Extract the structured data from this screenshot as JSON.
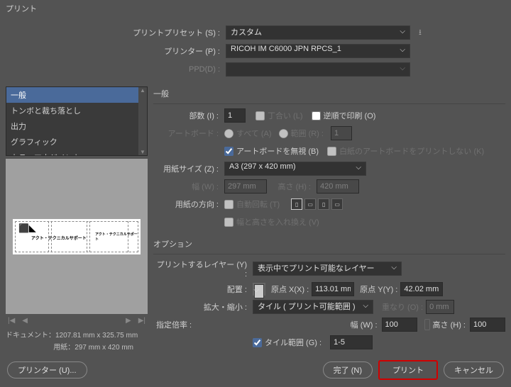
{
  "title": "プリント",
  "presets": {
    "preset_label": "プリントプリセット (S) :",
    "preset_value": "カスタム",
    "printer_label": "プリンター (P) :",
    "printer_value": "RICOH IM C6000 JPN RPCS_1",
    "ppd_label": "PPD(D) :",
    "ppd_value": ""
  },
  "sidebar": {
    "items": [
      "一般",
      "トンボと裁ち落とし",
      "出力",
      "グラフィック",
      "カラーマネジメント"
    ]
  },
  "preview": {
    "nav_page": "",
    "doc_label": "ドキュメント：",
    "doc_value": "1207.81 mm x 325.75 mm",
    "media_label": "用紙：",
    "media_value": "297 mm x 420 mm",
    "art_text1": "アクト・テクニカルサポート",
    "art_text2": "アクト・テクニカルサポート"
  },
  "general": {
    "heading": "一般",
    "copies_label": "部数 (I) :",
    "copies_value": "1",
    "collate_label": "丁合い (L)",
    "reverse_label": "逆順で印刷 (O)",
    "artboard_label": "アートボード :",
    "all_label": "すべて (A)",
    "range_label": "範囲 (R) :",
    "range_value": "1",
    "ignore_ab_label": "アートボードを無視 (B)",
    "skip_blank_label": "白紙のアートボードをプリントしない (K)",
    "size_label": "用紙サイズ (Z) :",
    "size_value": "A3 (297 x 420 mm)",
    "width_label": "幅 (W) :",
    "width_value": "297 mm",
    "height_label": "高さ (H) :",
    "height_value": "420 mm",
    "orient_label": "用紙の方向 :",
    "auto_rotate_label": "自動回転 (T)",
    "transverse_label": "幅と高さを入れ換え (V)"
  },
  "options": {
    "heading": "オプション",
    "layers_label": "プリントするレイヤー (Y) :",
    "layers_value": "表示中でプリント可能なレイヤー",
    "placement_label": "配置 :",
    "origin_x_label": "原点 X(X) :",
    "origin_x_value": "113.01 mm",
    "origin_y_label": "原点 Y(Y) :",
    "origin_y_value": "42.02 mm",
    "scale_label": "拡大・縮小 :",
    "scale_value": "タイル ( プリント可能範囲 )",
    "overlap_label": "重なり (O) :",
    "overlap_value": "0 mm",
    "mag_label": "指定倍率 :",
    "mag_w_label": "幅 (W) :",
    "mag_w_value": "100",
    "mag_h_label": "高さ (H) :",
    "mag_h_value": "100",
    "tile_range_label": "タイル範囲 (G) :",
    "tile_range_value": "1-5"
  },
  "footer": {
    "setup": "プリンター (U)...",
    "done": "完了 (N)",
    "print": "プリント",
    "cancel": "キャンセル"
  }
}
